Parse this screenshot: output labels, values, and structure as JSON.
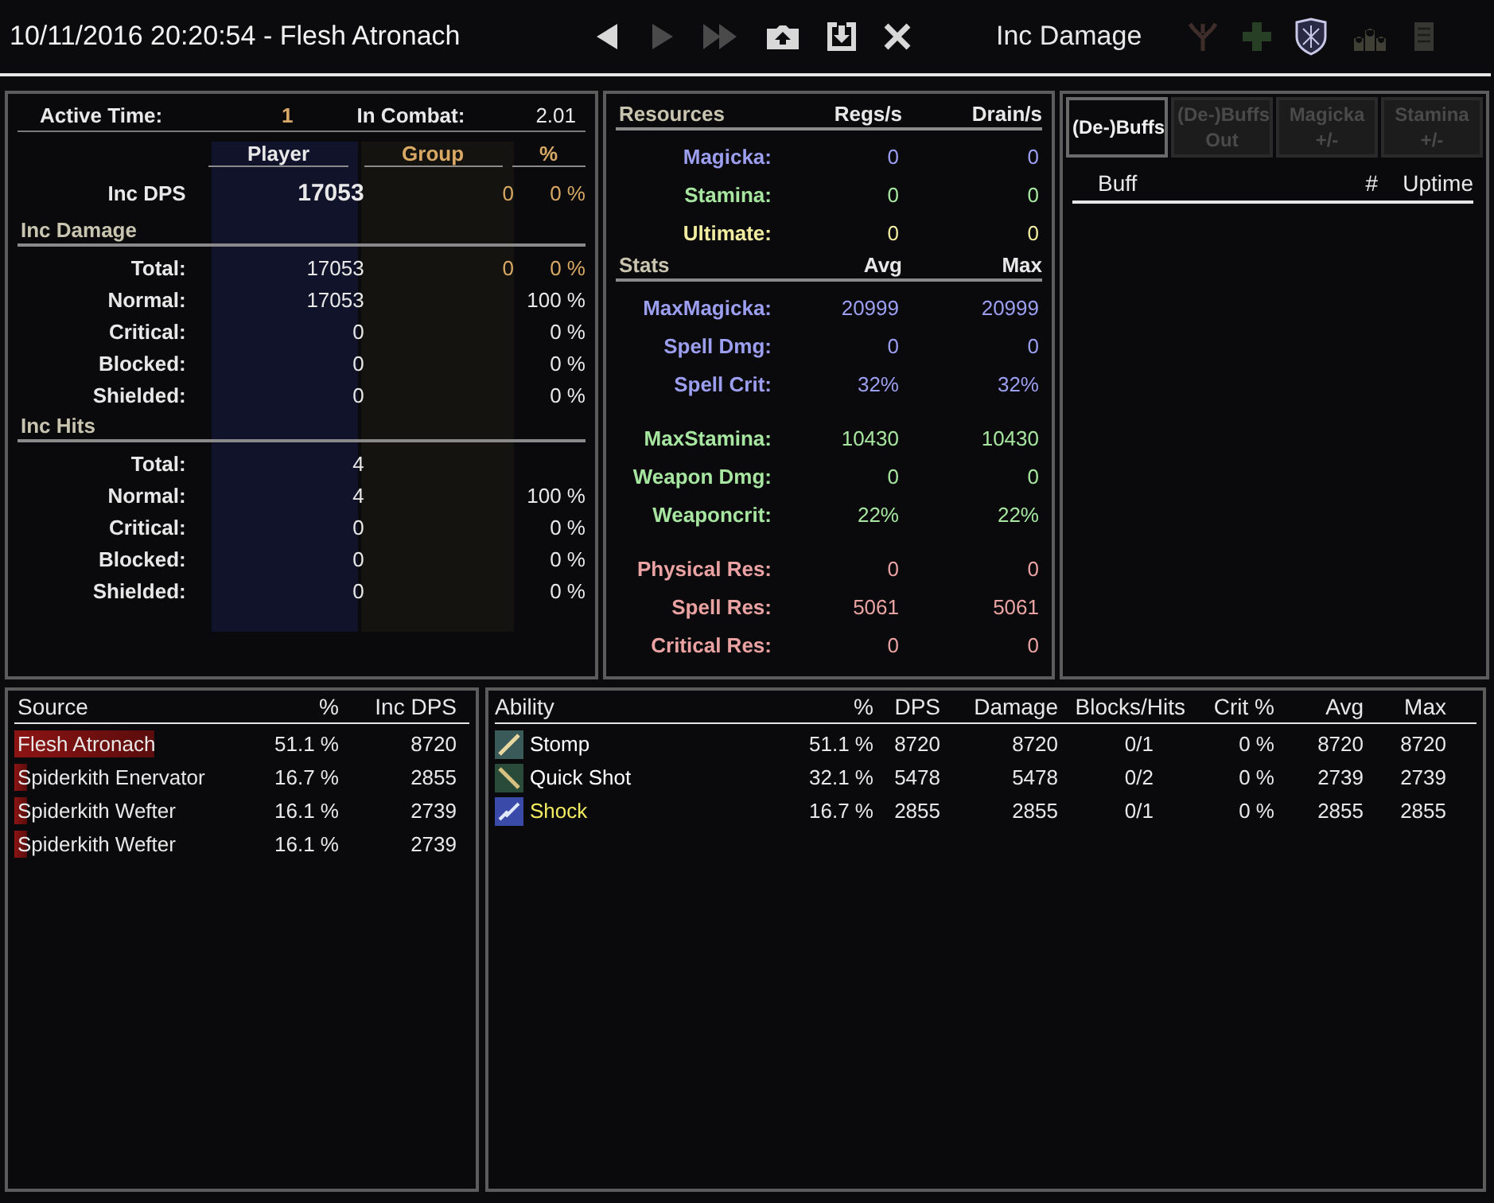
{
  "title_bar": {
    "title": "10/11/2016 20:20:54 - Flesh Atronach",
    "nav_buttons": [
      {
        "kind": "prev",
        "disabled": false
      },
      {
        "kind": "next",
        "disabled": true
      },
      {
        "kind": "last",
        "disabled": true
      },
      {
        "kind": "upload",
        "disabled": false
      },
      {
        "kind": "save",
        "disabled": false
      },
      {
        "kind": "close",
        "disabled": false
      }
    ],
    "mode_label": "Inc Damage",
    "mode_buttons": [
      {
        "kind": "tree",
        "selected": false
      },
      {
        "kind": "plus",
        "selected": false
      },
      {
        "kind": "shield",
        "selected": true
      },
      {
        "kind": "group",
        "selected": false
      },
      {
        "kind": "scroll",
        "selected": false
      }
    ]
  },
  "summary": {
    "active_time_label": "Active Time:",
    "active_time": "1",
    "in_combat_label": "In Combat:",
    "in_combat": "2.01",
    "columns": [
      "Player",
      "Group",
      "%"
    ],
    "dps": {
      "label": "Inc DPS",
      "player": "17053",
      "group": "0",
      "pct": "0 %"
    },
    "sections": [
      {
        "title": "Inc Damage",
        "rows": [
          {
            "label": "Total:",
            "player": "17053",
            "group": "0",
            "pct": "0 %"
          },
          {
            "label": "Normal:",
            "player": "17053",
            "pct": "100 %"
          },
          {
            "label": "Critical:",
            "player": "0",
            "pct": "0 %"
          },
          {
            "label": "Blocked:",
            "player": "0",
            "pct": "0 %"
          },
          {
            "label": "Shielded:",
            "player": "0",
            "pct": "0 %"
          }
        ]
      },
      {
        "title": "Inc Hits",
        "rows": [
          {
            "label": "Total:",
            "player": "4"
          },
          {
            "label": "Normal:",
            "player": "4",
            "pct": "100 %"
          },
          {
            "label": "Critical:",
            "player": "0",
            "pct": "0 %"
          },
          {
            "label": "Blocked:",
            "player": "0",
            "pct": "0 %"
          },
          {
            "label": "Shielded:",
            "player": "0",
            "pct": "0 %"
          }
        ]
      }
    ]
  },
  "stats": {
    "groups": [
      {
        "columns": [
          "Resources",
          "Regs/s",
          "Drain/s"
        ],
        "blocks": [
          [
            {
              "label": "Magicka:",
              "a": "0",
              "b": "0",
              "color": "#9c9ef0"
            },
            {
              "label": "Stamina:",
              "a": "0",
              "b": "0",
              "color": "#a6e6a0"
            },
            {
              "label": "Ultimate:",
              "a": "0",
              "b": "0",
              "color": "#f2eca0"
            }
          ]
        ]
      },
      {
        "columns": [
          "Stats",
          "Avg",
          "Max"
        ],
        "blocks": [
          [
            {
              "label": "MaxMagicka:",
              "a": "20999",
              "b": "20999",
              "color": "#9c9ef0"
            },
            {
              "label": "Spell Dmg:",
              "a": "0",
              "b": "0",
              "color": "#9c9ef0"
            },
            {
              "label": "Spell Crit:",
              "a": "32%",
              "b": "32%",
              "color": "#9c9ef0"
            }
          ],
          [
            {
              "label": "MaxStamina:",
              "a": "10430",
              "b": "10430",
              "color": "#a6e6a0"
            },
            {
              "label": "Weapon Dmg:",
              "a": "0",
              "b": "0",
              "color": "#a6e6a0"
            },
            {
              "label": "Weaponcrit:",
              "a": "22%",
              "b": "22%",
              "color": "#a6e6a0"
            }
          ],
          [
            {
              "label": "Physical Res:",
              "a": "0",
              "b": "0",
              "color": "#eaa2a2"
            },
            {
              "label": "Spell Res:",
              "a": "5061",
              "b": "5061",
              "color": "#eaa2a2"
            },
            {
              "label": "Critical Res:",
              "a": "0",
              "b": "0",
              "color": "#eaa2a2"
            }
          ]
        ]
      }
    ]
  },
  "buffs": {
    "tabs": [
      {
        "label": "(De-)Buffs",
        "selected": true
      },
      {
        "label": "(De-)Buffs Out",
        "selected": false
      },
      {
        "label": "Magicka +/-",
        "selected": false
      },
      {
        "label": "Stamina +/-",
        "selected": false
      }
    ],
    "columns": [
      "Buff",
      "#",
      "Uptime"
    ]
  },
  "sources": {
    "columns": [
      "Source",
      "%",
      "Inc DPS"
    ],
    "rows": [
      {
        "name": "Flesh Atronach",
        "pct": "51.1 %",
        "dps": "8720"
      },
      {
        "name": "Spiderkith Enervator",
        "pct": "16.7 %",
        "dps": "2855"
      },
      {
        "name": "Spiderkith Wefter",
        "pct": "16.1 %",
        "dps": "2739"
      },
      {
        "name": "Spiderkith Wefter",
        "pct": "16.1 %",
        "dps": "2739"
      }
    ]
  },
  "abilities": {
    "columns": [
      "Ability",
      "%",
      "DPS",
      "Damage",
      "Blocks/Hits",
      "Crit %",
      "Avg",
      "Max"
    ],
    "rows": [
      {
        "kind": "sword",
        "color": "#ffffff",
        "cells": [
          "Stomp",
          "51.1 %",
          "8720",
          "8720",
          "0/1",
          "0 %",
          "8720",
          "8720"
        ]
      },
      {
        "kind": "arrow",
        "color": "#ffffff",
        "cells": [
          "Quick Shot",
          "32.1 %",
          "5478",
          "5478",
          "0/2",
          "0 %",
          "2739",
          "2739"
        ]
      },
      {
        "kind": "spark",
        "color": "#f4ec60",
        "cells": [
          "Shock",
          "16.7 %",
          "2855",
          "2855",
          "0/1",
          "0 %",
          "2855",
          "2855"
        ]
      }
    ]
  }
}
